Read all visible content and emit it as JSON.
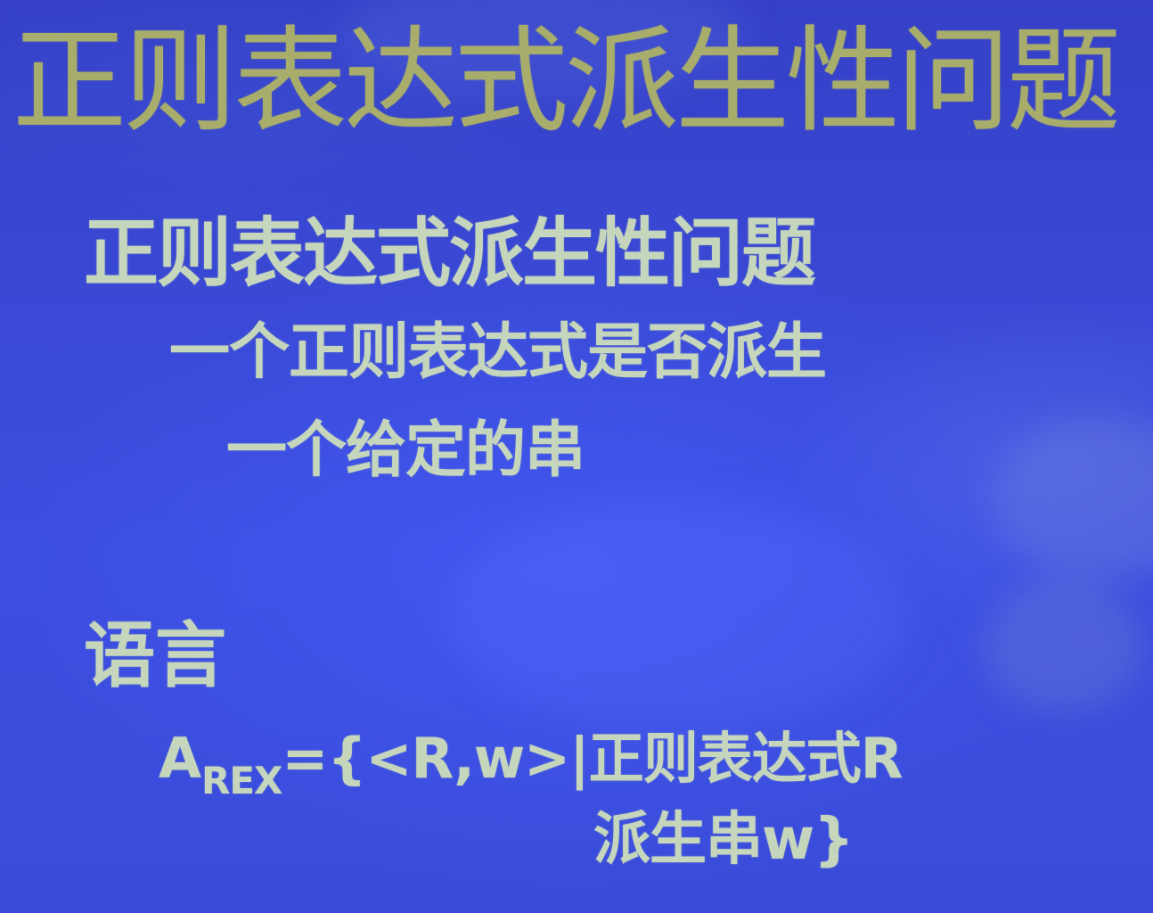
{
  "slide": {
    "title": "正则表达式派生性问题",
    "heading1": "正则表达式派生性问题",
    "sub1": "一个正则表达式是否派生",
    "sub2": "一个给定的串",
    "heading2": "语言",
    "formula": {
      "symbol": "A",
      "subscript": "REX",
      "line1_rest": "={<R,w>|正则表达式R",
      "line2": "派生串w}"
    }
  },
  "colors": {
    "background": "#3a49d6",
    "title": "#a8ad6c",
    "body_text": "#c5d6bd"
  }
}
